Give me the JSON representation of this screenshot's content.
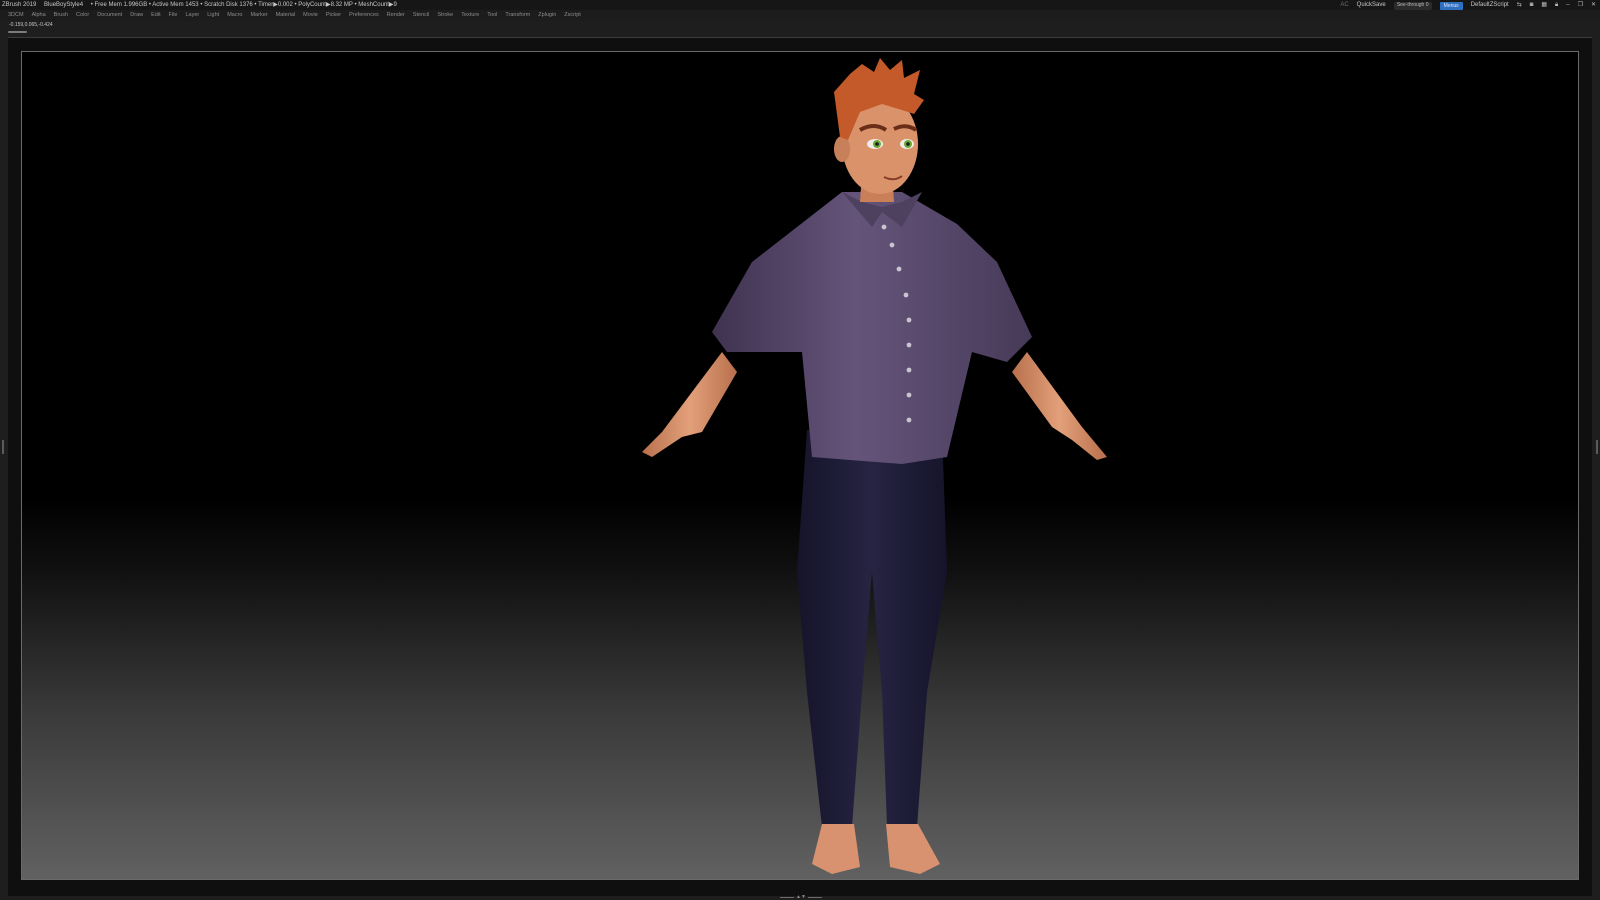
{
  "titlebar": {
    "app": "ZBrush 2019",
    "theme": "BlueBoyStyle4",
    "stats": "• Free Mem 1.996GB • Active Mem 1453 • Scratch Disk 1376 • Timer▶0.002 • PolyCount▶8.32 MP • MeshCount▶9",
    "ac": "AC",
    "quicksave": "QuickSave",
    "see_through": "See-through   0",
    "see_through_value": 0,
    "menus_badge": "Menus",
    "script": "DefaultZScript",
    "icons": [
      "arrows-icon",
      "camera-icon",
      "layout-icon",
      "lock-icon",
      "minimize-icon",
      "restore-icon",
      "close-icon"
    ]
  },
  "menubar": {
    "items": [
      "3DCM",
      "Alpha",
      "Brush",
      "Color",
      "Document",
      "Draw",
      "Edit",
      "File",
      "Layer",
      "Light",
      "Macro",
      "Marker",
      "Material",
      "Movie",
      "Picker",
      "Preferences",
      "Render",
      "Stencil",
      "Stroke",
      "Texture",
      "Tool",
      "Transform",
      "Zplugin",
      "Zscript"
    ]
  },
  "status": {
    "coords": "-0.159,0.065,-0.424"
  },
  "colors": {
    "accent": "#2f6fbf",
    "shirt": "#5b4a6b",
    "pants": "#1f1d33",
    "skin": "#d9926a",
    "hair": "#c45a2a",
    "eyes": "#6aa83a"
  }
}
